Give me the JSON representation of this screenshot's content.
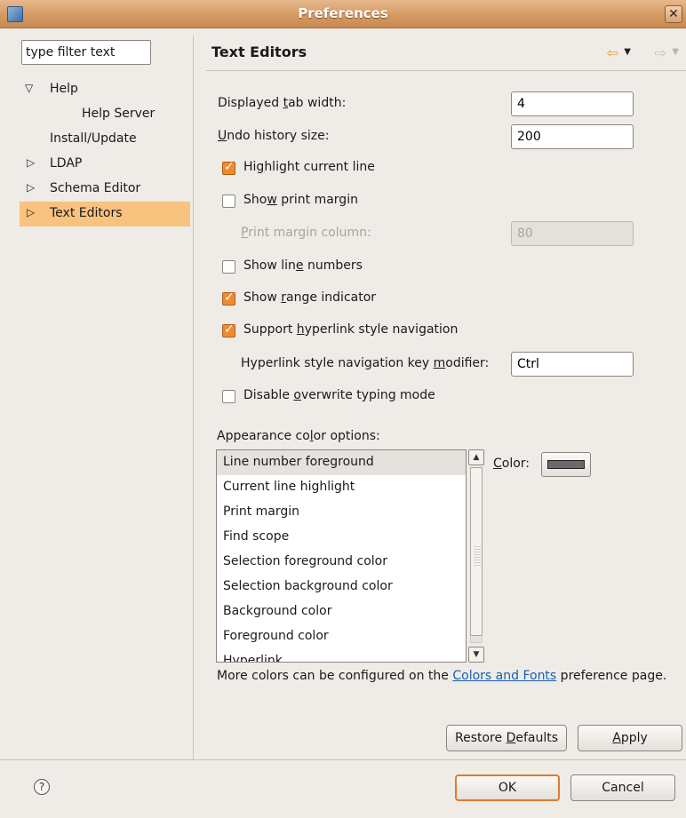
{
  "window": {
    "title": "Preferences",
    "close_glyph": "✕"
  },
  "sidebar": {
    "filter_value": "type filter text",
    "items": [
      {
        "label": "Help",
        "arrow": "expanded",
        "indent": 0
      },
      {
        "label": "Help Server",
        "arrow": "none",
        "indent": 1
      },
      {
        "label": "Install/Update",
        "arrow": "none",
        "indent": 0
      },
      {
        "label": "LDAP",
        "arrow": "collapsed",
        "indent": 0
      },
      {
        "label": "Schema Editor",
        "arrow": "collapsed",
        "indent": 0
      },
      {
        "label": "Text Editors",
        "arrow": "collapsed",
        "indent": 0,
        "selected": true
      }
    ]
  },
  "page": {
    "title": "Text Editors",
    "icons": {
      "back": "arrow-left-icon",
      "forward": "arrow-right-icon"
    }
  },
  "settings": {
    "tab_width": {
      "label_pre": "Displayed ",
      "label_key": "t",
      "label_post": "ab width:",
      "value": "4"
    },
    "undo_history": {
      "label_pre": "",
      "label_key": "U",
      "label_post": "ndo history size:",
      "value": "200"
    },
    "highlight_line": {
      "label_pre": "Hi",
      "label_key": "g",
      "label_post": "hlight current line",
      "checked": true
    },
    "print_margin": {
      "label_pre": "Sho",
      "label_key": "w",
      "label_post": " print margin",
      "checked": false
    },
    "print_margin_column": {
      "label_pre": "",
      "label_key": "P",
      "label_post": "rint margin column:",
      "value": "80",
      "disabled": true
    },
    "line_numbers": {
      "label_pre": "Show lin",
      "label_key": "e",
      "label_post": " numbers",
      "checked": false
    },
    "range_indicator": {
      "label_pre": "Show ",
      "label_key": "r",
      "label_post": "ange indicator",
      "checked": true
    },
    "hyperlink": {
      "label_pre": "Support ",
      "label_key": "h",
      "label_post": "yperlink style navigation",
      "checked": true
    },
    "hyperlink_modifier": {
      "label_pre": "Hyperlink style navigation key ",
      "label_key": "m",
      "label_post": "odifier:",
      "value": "Ctrl"
    },
    "overwrite": {
      "label_pre": "Disable ",
      "label_key": "o",
      "label_post": "verwrite typing mode",
      "checked": false
    }
  },
  "appearance": {
    "label_pre": "Appearance co",
    "label_key": "l",
    "label_post": "or options:",
    "items": [
      "Line number foreground",
      "Current line highlight",
      "Print margin",
      "Find scope",
      "Selection foreground color",
      "Selection background color",
      "Background color",
      "Foreground color",
      "Hyperlink"
    ],
    "selected_index": 0,
    "color_label_pre": "",
    "color_label_key": "C",
    "color_label_post": "olor:",
    "swatch_color": "#6a6a6a"
  },
  "footer_note": {
    "pre": "More colors can be configured on the ",
    "link": "Colors and Fonts",
    "post": " preference page."
  },
  "buttons": {
    "restore_pre": "Restore ",
    "restore_key": "D",
    "restore_post": "efaults",
    "apply_key": "A",
    "apply_post": "pply",
    "ok": "OK",
    "cancel": "Cancel",
    "help_glyph": "?"
  },
  "colors": {
    "accent": "#f08a2f",
    "selection": "#f8c27f",
    "titlebar": "#d49a62",
    "link": "#1a5fb4"
  }
}
